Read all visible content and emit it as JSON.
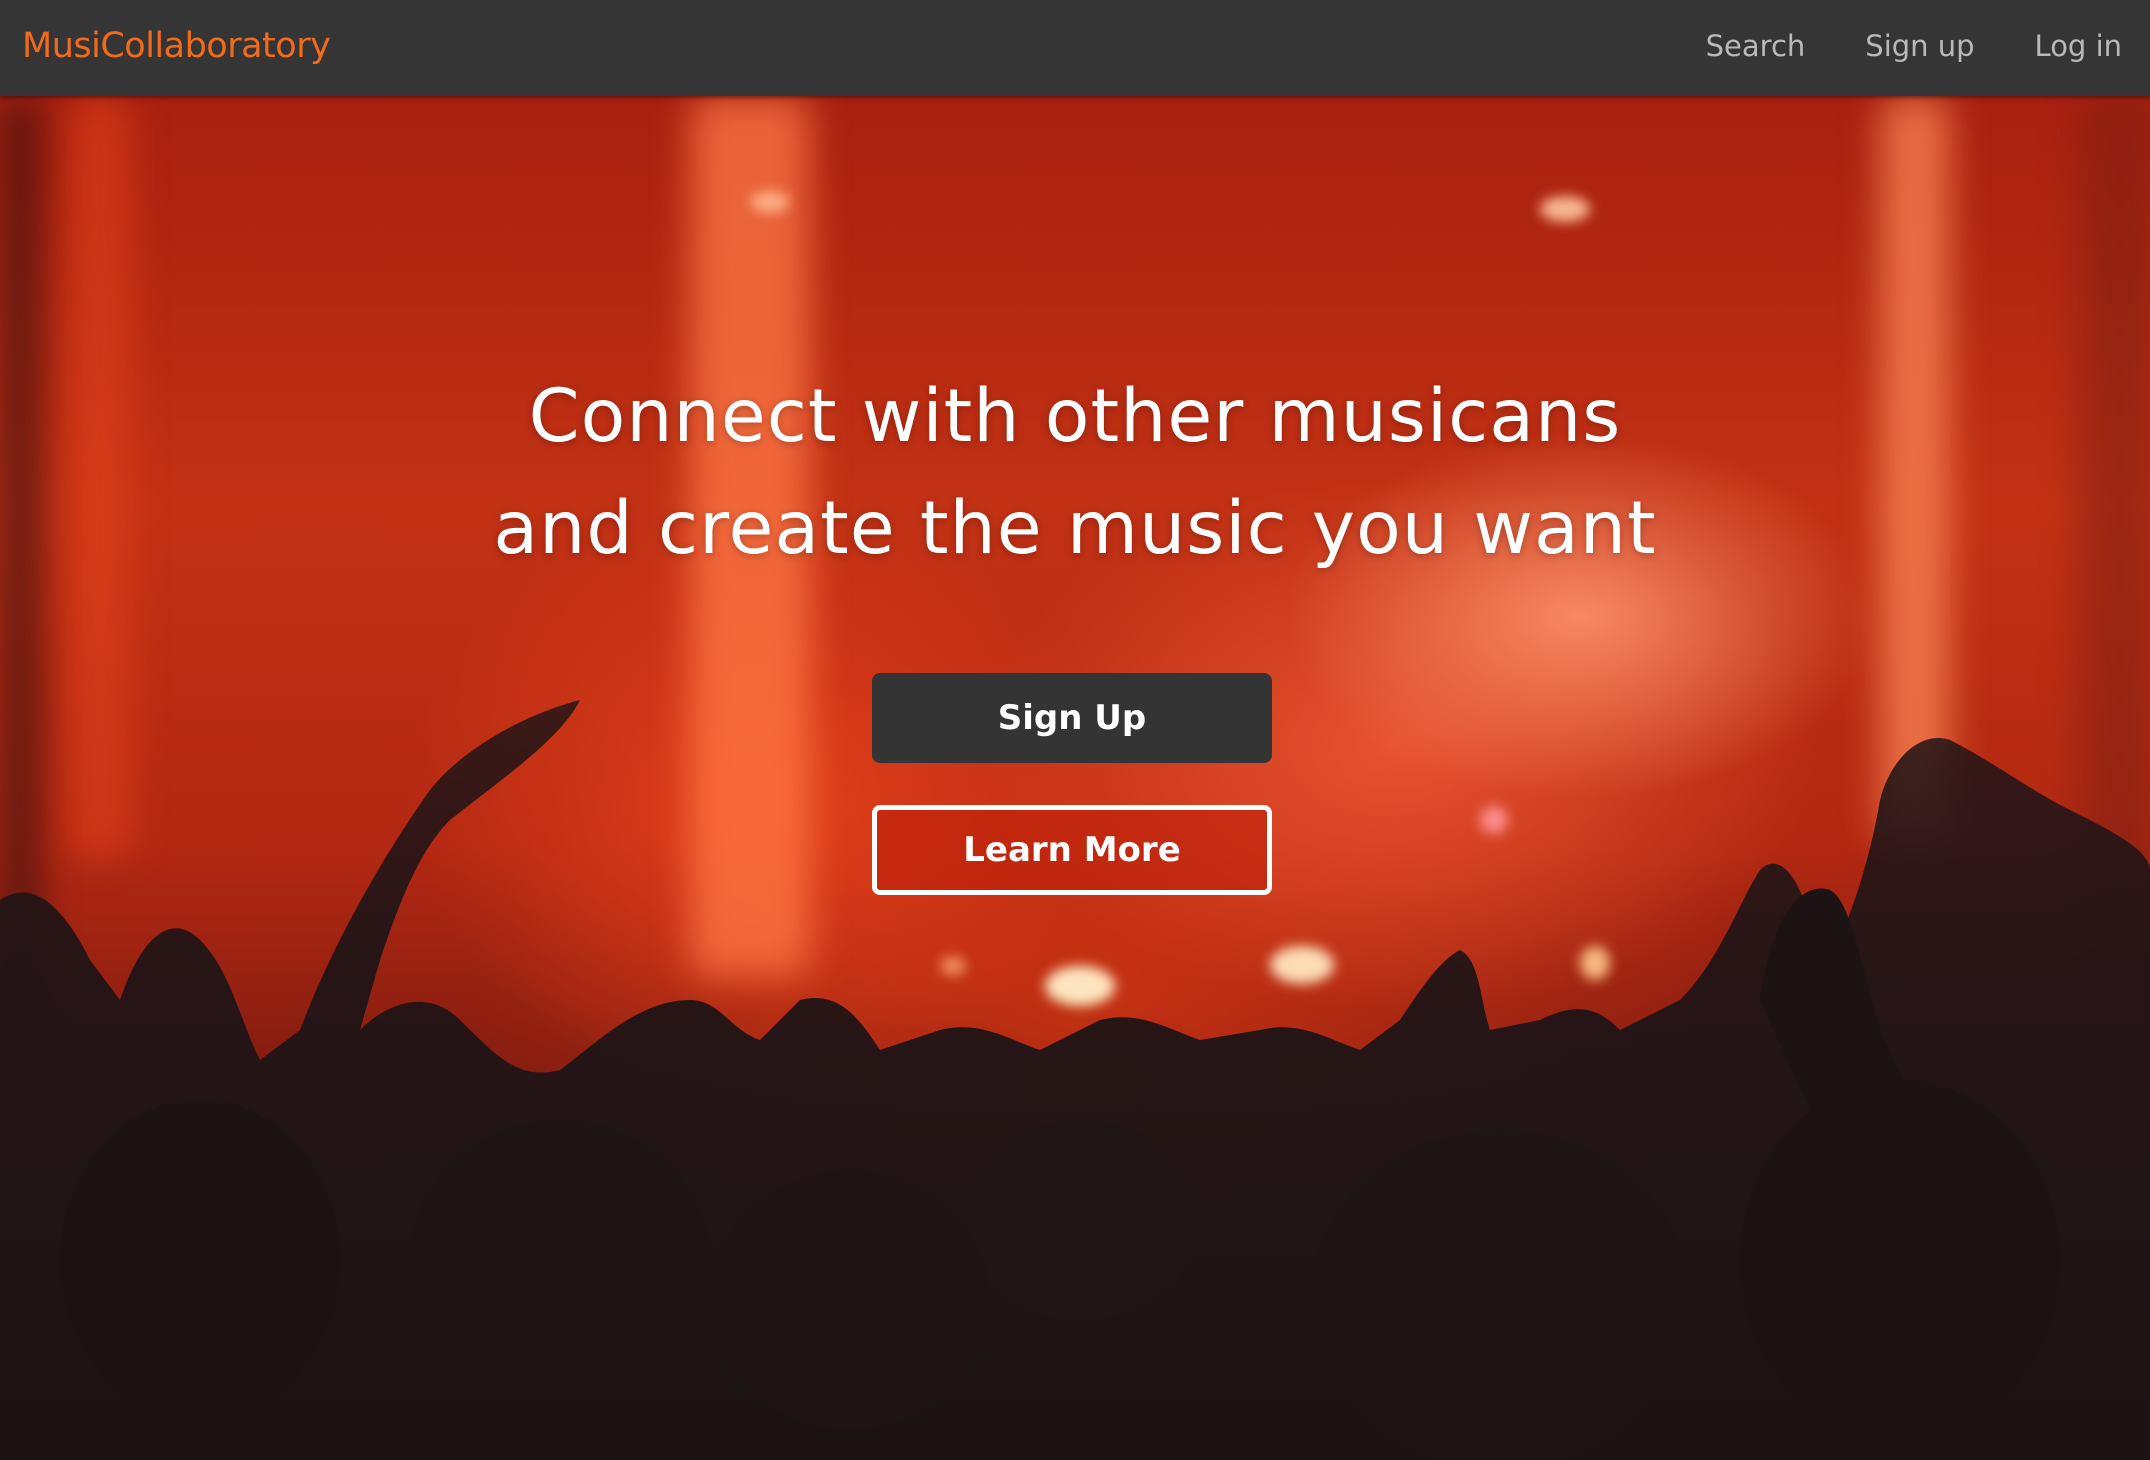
{
  "navbar": {
    "brand": "MusiCollaboratory",
    "links": [
      {
        "label": "Search"
      },
      {
        "label": "Sign up"
      },
      {
        "label": "Log in"
      }
    ]
  },
  "hero": {
    "headline_line1": "Connect with other musicans",
    "headline_line2": "and create the music you want",
    "primary_button": "Sign Up",
    "secondary_button": "Learn More"
  },
  "colors": {
    "brand": "#f26a1b",
    "navbar_bg": "#353535",
    "button_dark": "#343434",
    "accent_red": "#c23114"
  }
}
